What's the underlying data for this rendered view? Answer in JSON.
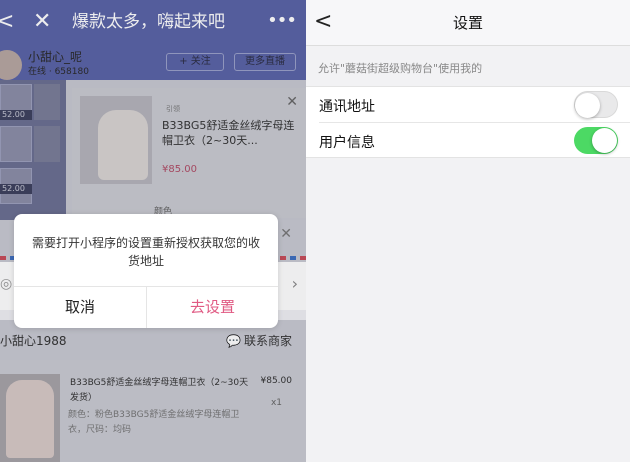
{
  "left": {
    "nav": {
      "back_glyph": "<",
      "close_glyph": "✕",
      "title": "爆款太多，嗨起来吧",
      "more_glyph": "•••"
    },
    "header": {
      "name": "小甜心_呢",
      "sub": "在线 · 658180",
      "follow": "+ 关注",
      "more_live": "更多直播"
    },
    "thumbs": [
      "52.00",
      "52.00"
    ],
    "product": {
      "tag": "引领",
      "title": "B33BG5舒适金丝绒字母连帽卫衣（2~30天...",
      "price": "¥85.00",
      "color": "颜色"
    },
    "dialog": {
      "message": "需要打开小程序的设置重新授权获取您的收货地址",
      "cancel": "取消",
      "confirm": "去设置"
    },
    "shop": {
      "name": "小甜心1988",
      "contact": "联系商家"
    },
    "order_item": {
      "title": "B33BG5舒适金丝绒字母连帽卫衣（2~30天发货）",
      "price": "¥85.00",
      "qty": "x1",
      "spec": "颜色：粉色B33BG5舒适金丝绒字母连帽卫衣，尺码：均码"
    }
  },
  "right": {
    "nav": {
      "back_glyph": "<",
      "title": "设置"
    },
    "caption": "允许\"蘑菇街超级购物台\"使用我的",
    "permissions": [
      {
        "label": "通讯地址",
        "enabled": false
      },
      {
        "label": "用户信息",
        "enabled": true
      }
    ],
    "colors": {
      "toggle_on": "#4cd964",
      "dialog_confirm": "#e05a83",
      "left_header": "#5a63a6"
    }
  }
}
